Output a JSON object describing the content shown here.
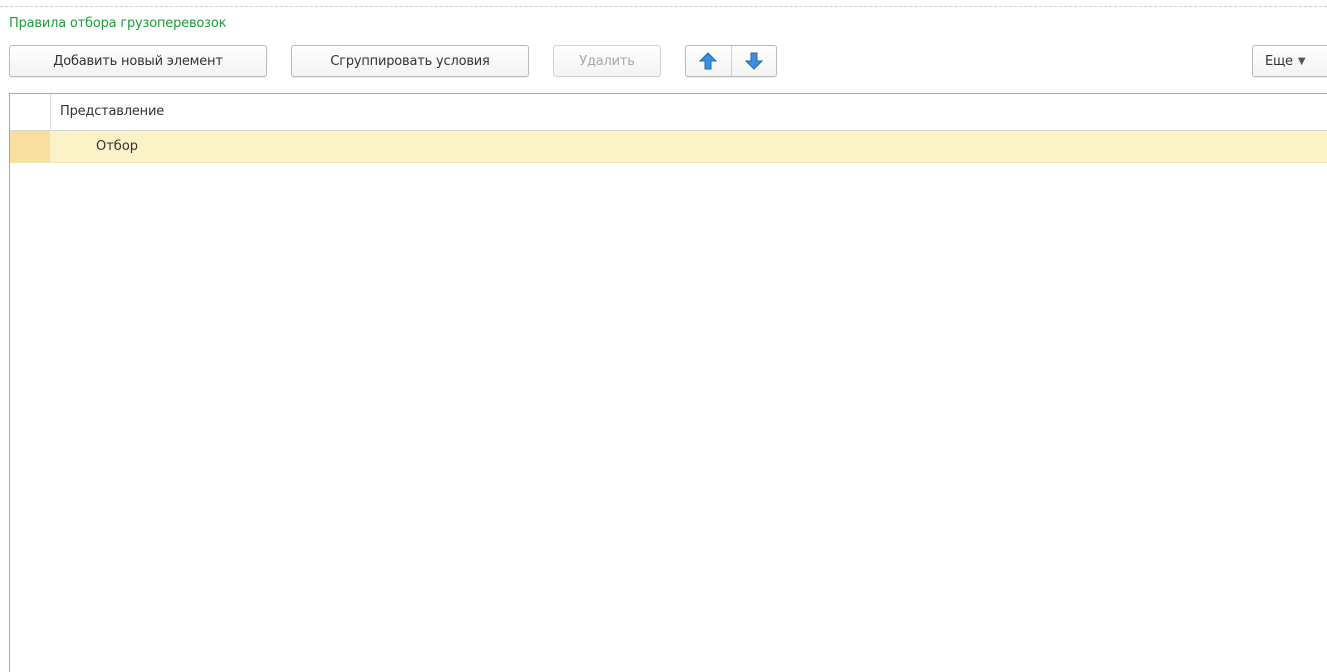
{
  "section": {
    "title": "Правила отбора грузоперевозок",
    "title_color": "#1c9e3a"
  },
  "toolbar": {
    "add_label": "Добавить новый элемент",
    "group_label": "Сгруппировать условия",
    "delete_label": "Удалить",
    "move_up_icon": "arrow-up-icon",
    "move_down_icon": "arrow-down-icon",
    "more_label": "Еще",
    "arrow_color": "#3d8ee0"
  },
  "table": {
    "columns": [
      "Представление"
    ],
    "rows": [
      {
        "label": "Отбор",
        "selected": true
      }
    ],
    "selected_row_color": "#fbf2c8"
  }
}
